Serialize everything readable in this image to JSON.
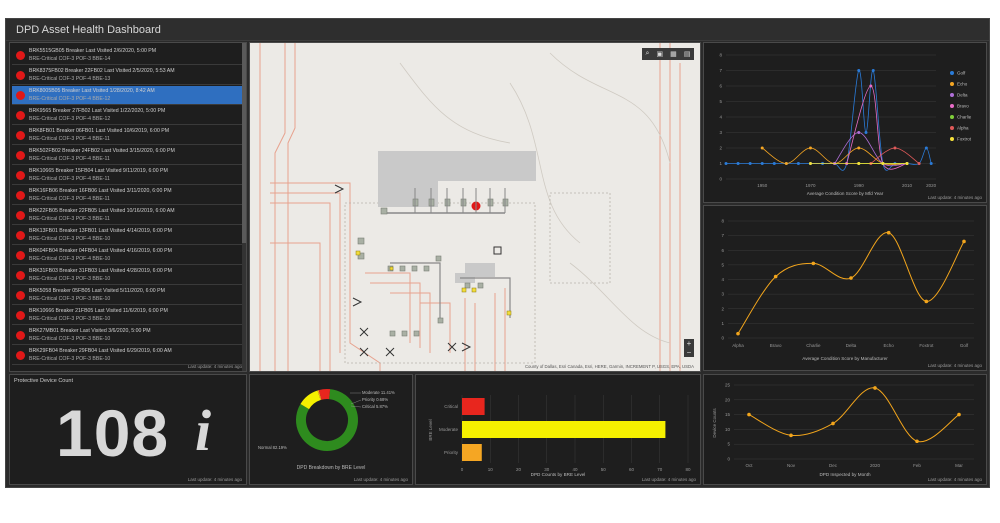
{
  "app_title": "DPD Asset Health Dashboard",
  "list_items": [
    {
      "line1": "BRK5515GB05 Breaker   Last Visited 2/6/2020, 5:00 PM",
      "line2": "BRE-Critical COF-3 POF-3 BBE-14",
      "selected": false
    },
    {
      "line1": "BRK8375FB02 Breaker 22FB02   Last Visited 2/5/2020, 5:53 AM",
      "line2": "BRE-Critical COF-3 POF-4 BBE-13",
      "selected": false
    },
    {
      "line1": "BRK8005B05 Breaker   Last Visited 1/28/2020, 8:42 AM",
      "line2": "BRE-Critical COF-3 POF-4 BBE-12",
      "selected": true
    },
    {
      "line1": "BRK9565 Breaker 27FB02   Last Visited 1/22/2020, 5:00 PM",
      "line2": "BRE-Critical COF-3 POF-4 BBE-12",
      "selected": false
    },
    {
      "line1": "BRK8FB01 Breaker 06FB01   Last Visited 10/6/2019, 6:00 PM",
      "line2": "BRE-Critical COF-3 POF-4 BBE-11",
      "selected": false
    },
    {
      "line1": "BRK502FB02 Breaker 24FB02   Last Visited 3/15/2020, 6:00 PM",
      "line2": "BRE-Critical COF-3 POF-4 BBE-11",
      "selected": false
    },
    {
      "line1": "BRK10665 Breaker 15FB04   Last Visited 9/11/2019, 6:00 PM",
      "line2": "BRE-Critical COF-3 POF-4 BBE-11",
      "selected": false
    },
    {
      "line1": "BRK16FB06 Breaker 16FB06   Last Visited 3/11/2020, 6:00 PM",
      "line2": "BRE-Critical COF-3 POF-4 BBE-11",
      "selected": false
    },
    {
      "line1": "BRK22FB05 Breaker 22FB05   Last Visited 10/16/2019, 6:00 AM",
      "line2": "BRE-Critical COF-3 POF-3 BBE-11",
      "selected": false
    },
    {
      "line1": "BRK13FB01 Breaker 13FB01   Last Visited 4/14/2019, 6:00 PM",
      "line2": "BRE-Critical COF-3 POF-4 BBE-10",
      "selected": false
    },
    {
      "line1": "BRK04FB04 Breaker 04FB04   Last Visited 4/16/2019, 6:00 PM",
      "line2": "BRE-Critical COF-3 POF-4 BBE-10",
      "selected": false
    },
    {
      "line1": "BRK31FB03 Breaker 31FB03   Last Visited 4/28/2019, 6:00 PM",
      "line2": "BRE-Critical COF-3 POF-3 BBE-10",
      "selected": false
    },
    {
      "line1": "BRK5058 Breaker 05FB05   Last Visited 5/11/2020, 6:00 PM",
      "line2": "BRE-Critical COF-3 POF-3 BBE-10",
      "selected": false
    },
    {
      "line1": "BRK10666 Breaker 21FB05   Last Visited 11/6/2019, 6:00 PM",
      "line2": "BRE-Critical COF-3 POF-3 BBE-10",
      "selected": false
    },
    {
      "line1": "BRK27MB01 Breaker   Last Visited 3/6/2020, 5:00 PM",
      "line2": "BRE-Critical COF-3 POF-3 BBE-10",
      "selected": false
    },
    {
      "line1": "BRK29FB04 Breaker 29FB04   Last Visited 6/29/2019, 6:00 AM",
      "line2": "BRE-Critical COF-3 POF-3 BBE-10",
      "selected": false
    }
  ],
  "last_update": "Last update: 4 minutes ago",
  "map": {
    "attribution": "County of Dallas, Esri Canada, Esri, HERE, Garmin, INCREMENT P, USGS, EPA, USDA",
    "tools": [
      "⌕",
      "▣",
      "▦",
      "▤"
    ],
    "zoom_in": "+",
    "zoom_out": "−"
  },
  "counter": {
    "title": "Protective Device Count",
    "value": "108",
    "icon": "i"
  },
  "colors": {
    "critical": "#e8261e",
    "moderate": "#f5f000",
    "priority": "#f5a623",
    "healthy": "#2e8b1e",
    "line": "#f2a51c",
    "blue": "#2a7bd8"
  },
  "chart_data": [
    {
      "type": "line",
      "caption": "Average Condition Score by Mfd Year",
      "x_ticks": [
        "1950",
        "1970",
        "1990",
        "2010",
        "2020"
      ],
      "y_ticks": [
        "0",
        "1",
        "2",
        "3",
        "4",
        "5",
        "6",
        "7",
        "8"
      ],
      "ylim": [
        0,
        8
      ],
      "legend_position": "right",
      "series": [
        {
          "name": "Golf",
          "color": "#2a7bd8",
          "x": [
            1935,
            1940,
            1945,
            1950,
            1955,
            1960,
            1965,
            1970,
            1975,
            1980,
            1985,
            1990,
            1993,
            1996,
            2000,
            2005,
            2010,
            2015,
            2018,
            2020
          ],
          "y": [
            1,
            1,
            1,
            1,
            1,
            1,
            1,
            1,
            1,
            1,
            1,
            7,
            3,
            7,
            1,
            1,
            1,
            1,
            2,
            1
          ]
        },
        {
          "name": "Echo",
          "color": "#f5a623",
          "x": [
            1950,
            1960,
            1970,
            1980,
            1990,
            2000,
            2010
          ],
          "y": [
            2,
            1,
            2,
            1,
            2,
            1,
            1
          ]
        },
        {
          "name": "Delta",
          "color": "#b06fd8",
          "x": [
            1980,
            1990,
            2000,
            2010
          ],
          "y": [
            1,
            3,
            1,
            1
          ]
        },
        {
          "name": "Bravo",
          "color": "#e86cc8",
          "x": [
            1985,
            1995,
            2000,
            2010
          ],
          "y": [
            1,
            6,
            1,
            1
          ]
        },
        {
          "name": "Charlie",
          "color": "#7fcf3a",
          "x": [
            1990,
            2000,
            2010
          ],
          "y": [
            1,
            1,
            1
          ]
        },
        {
          "name": "Alpha",
          "color": "#e05a5a",
          "x": [
            1995,
            2005,
            2015
          ],
          "y": [
            1,
            2,
            1
          ]
        },
        {
          "name": "Foxtrot",
          "color": "#f5e03a",
          "x": [
            1970,
            1990,
            2000,
            2010
          ],
          "y": [
            1,
            1,
            1,
            1
          ]
        }
      ]
    },
    {
      "type": "line",
      "caption": "Average Condition Score by Manufacturer",
      "categories": [
        "Alpha",
        "Bravo",
        "Charlie",
        "Delta",
        "Echo",
        "Foxtrot",
        "Golf"
      ],
      "values": [
        0.3,
        4.2,
        5.1,
        4.1,
        7.2,
        2.5,
        6.6
      ],
      "y_ticks": [
        "0",
        "1",
        "2",
        "3",
        "4",
        "5",
        "6",
        "7",
        "8"
      ],
      "ylim": [
        0,
        8
      ]
    },
    {
      "type": "line",
      "caption": "DPD Inspected by Month",
      "ylabel": "Device Counts",
      "categories": [
        "Oct",
        "Nov",
        "Dec",
        "2020",
        "Feb",
        "Mar"
      ],
      "values": [
        15,
        8,
        12,
        24,
        6,
        15
      ],
      "y_ticks": [
        "0",
        "5",
        "10",
        "15",
        "20",
        "25"
      ],
      "ylim": [
        0,
        25
      ]
    },
    {
      "type": "pie",
      "caption": "DPD Breakdown by BRE Level",
      "slices": [
        {
          "name": "Normal",
          "label": "Normal 82.19%",
          "value": 82.19,
          "color": "#2e8b1e"
        },
        {
          "name": "Moderate",
          "label": "Moderate 11.41%",
          "value": 11.41,
          "color": "#f5f000"
        },
        {
          "name": "Priority",
          "label": "Priority 0.68%",
          "value": 0.68,
          "color": "#f5a623"
        },
        {
          "name": "Critical",
          "label": "Critical 5.87%",
          "value": 5.87,
          "color": "#e8261e"
        }
      ]
    },
    {
      "type": "bar",
      "caption": "DPD Counts by BRE Level",
      "ylabel": "BRE Level",
      "categories": [
        "Critical",
        "Moderate",
        "Priority"
      ],
      "values": [
        8,
        72,
        7
      ],
      "x_ticks": [
        "0",
        "10",
        "20",
        "30",
        "40",
        "50",
        "60",
        "70",
        "80"
      ],
      "xlim": [
        0,
        80
      ]
    }
  ]
}
